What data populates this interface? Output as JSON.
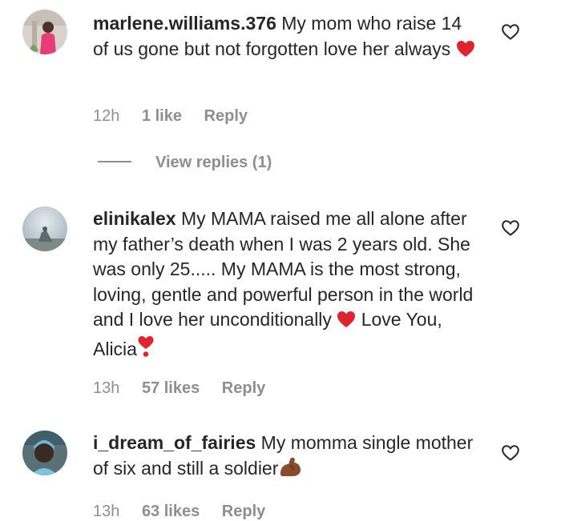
{
  "comments": [
    {
      "username": "marlene.williams.376",
      "text": "My mom who raise 14 of us gone but not forgotten love her always",
      "time": "12h",
      "likes": "1 like",
      "reply": "Reply",
      "view_replies": "View replies (1)"
    },
    {
      "username": "elinikalex",
      "text_part1": "My MAMA raised me all alone after my father’s death when I was 2 years old. She was only 25..... My MAMA is the most strong, loving, gentle and powerful person in the world and I love her unconditionally",
      "text_part2": "Love You, Alicia",
      "time": "13h",
      "likes": "57 likes",
      "reply": "Reply"
    },
    {
      "username": "i_dream_of_fairies",
      "text": "My momma single mother of six and still a soldier",
      "time": "13h",
      "likes": "63 likes",
      "reply": "Reply"
    }
  ],
  "colors": {
    "text": "#262626",
    "secondary": "#8e8e8e",
    "heart_emoji": "#e0242f",
    "flexed_arm_emoji": "#8a4a2a"
  }
}
